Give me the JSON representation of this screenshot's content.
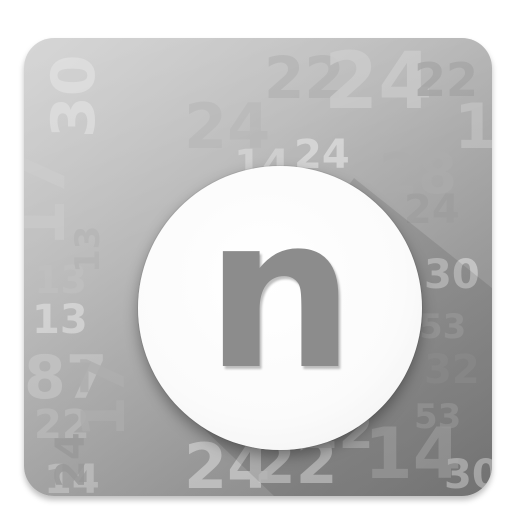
{
  "app_icon": {
    "letter": "n",
    "background_numbers": [
      "30",
      "22",
      "24",
      "22",
      "13",
      "24",
      "14",
      "24",
      "28",
      "17",
      "24",
      "13",
      "13",
      "30",
      "13",
      "53",
      "87",
      "32",
      "22",
      "17",
      "24",
      "22",
      "53",
      "14",
      "24",
      "22",
      "14",
      "30"
    ],
    "colors": {
      "tile_light": "#c9c9c9",
      "tile_dark": "#8a8a8a",
      "badge": "#ffffff",
      "letter": "#8c8c8c"
    }
  }
}
